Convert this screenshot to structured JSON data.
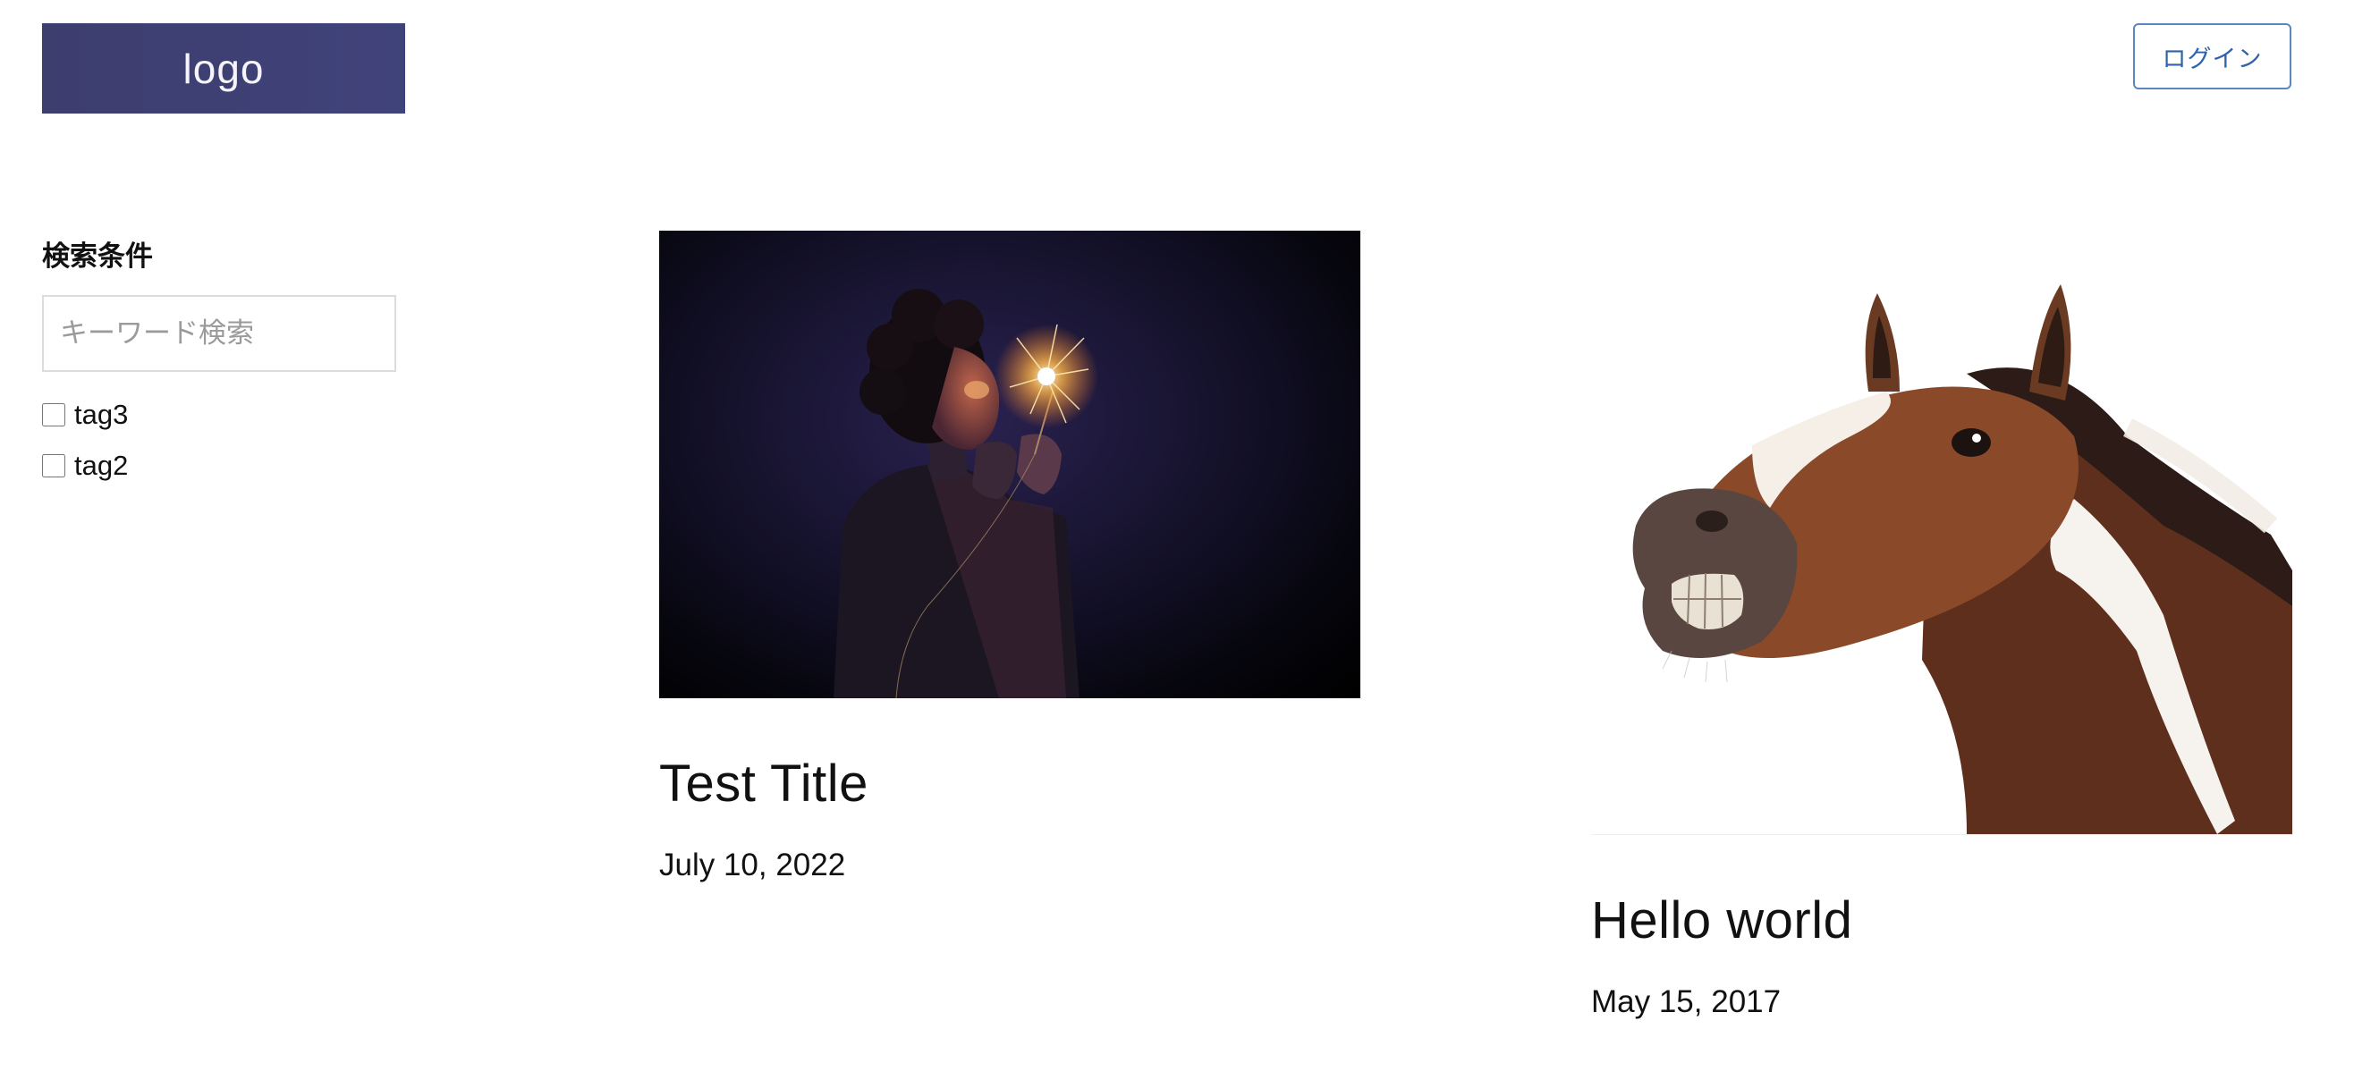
{
  "header": {
    "logo_text": "logo",
    "login_label": "ログイン"
  },
  "sidebar": {
    "title": "検索条件",
    "search": {
      "placeholder": "キーワード検索",
      "value": ""
    },
    "tags": [
      {
        "label": "tag3",
        "checked": false
      },
      {
        "label": "tag2",
        "checked": false
      }
    ]
  },
  "articles": [
    {
      "title": "Test Title",
      "date": "July 10, 2022",
      "image": "person-with-sparkler-photo"
    },
    {
      "title": "Hello world",
      "date": "May 15, 2017",
      "image": "laughing-horse-photo"
    }
  ],
  "colors": {
    "logo_bg": "#3e4074",
    "login_border": "#5b86c0",
    "login_text": "#2f62a8"
  }
}
